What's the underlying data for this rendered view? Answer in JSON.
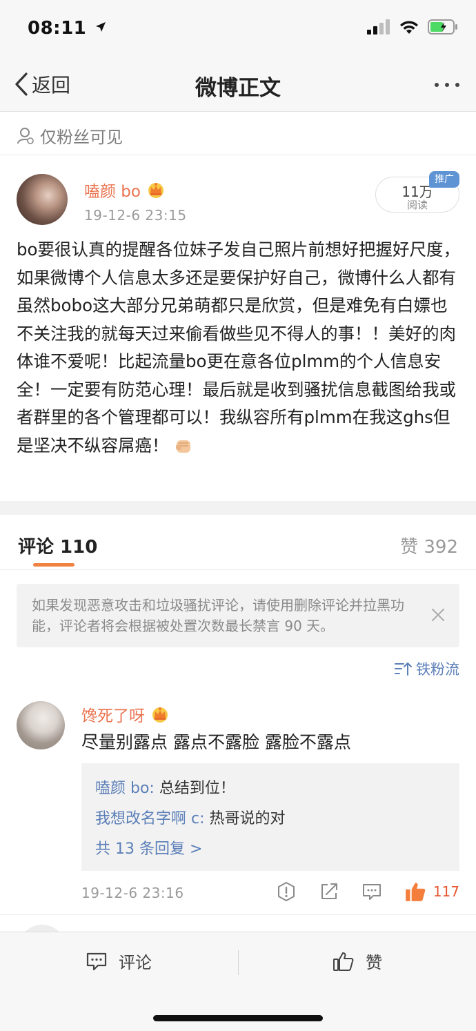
{
  "status_bar": {
    "time": "08:11"
  },
  "nav": {
    "back_label": "返回",
    "title": "微博正文"
  },
  "visibility": {
    "label": "仅粉丝可见"
  },
  "post": {
    "author": "嗑颜 bo",
    "time": "19-12-6 23:15",
    "reads": "11万",
    "reads_label": "阅读",
    "promo_badge": "推广",
    "body": "bo要很认真的提醒各位妹子发自己照片前想好把握好尺度，如果微博个人信息太多还是要保护好自己，微博什么人都有虽然bobo这大部分兄弟萌都只是欣赏，但是难免有白嫖也不关注我的就每天过来偷看做些见不得人的事！！美好的肉体谁不爱呢！比起流量bo更在意各位plmm的个人信息安全！一定要有防范心理！最后就是收到骚扰信息截图给我或者群里的各个管理都可以！我纵容所有plmm在我这ghs但是坚决不纵容屌癌！"
  },
  "tabs": {
    "comments": "评论 110",
    "likes": "赞 392"
  },
  "notice": {
    "text": "如果发现恶意攻击和垃圾骚扰评论，请使用删除评论并拉黑功能，评论者将会根据被处置次数最长禁言 90 天。"
  },
  "sort": {
    "label": "铁粉流"
  },
  "comment": {
    "author": "馋死了呀",
    "text": "尽量别露点 露点不露脸 露脸不露点",
    "replies": [
      {
        "author": "嗑颜 bo:",
        "text": " 总结到位！"
      },
      {
        "author": "我想改名字啊 c:",
        "text": " 热哥说的对"
      }
    ],
    "more_replies": "共 13 条回复 >",
    "time": "19-12-6 23:16",
    "likes": "117"
  },
  "bottom_bar": {
    "comment_label": "评论",
    "like_label": "赞"
  },
  "colors": {
    "accent_orange": "#eb7350",
    "link_blue": "#5b7fb8",
    "tab_indicator": "#f08341",
    "battery_green": "#4cd964",
    "like_red": "#e8562f"
  }
}
